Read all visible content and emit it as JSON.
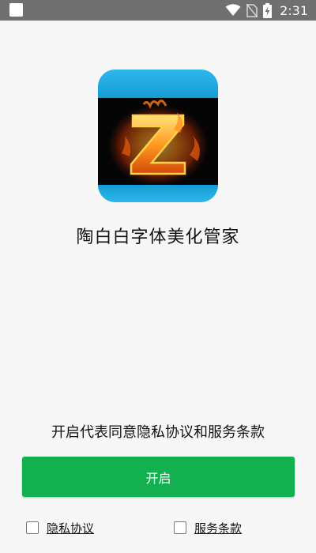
{
  "status_bar": {
    "time": "2:31",
    "icons": [
      "app-notification-icon",
      "wifi-icon",
      "no-sim-icon",
      "battery-charging-icon"
    ]
  },
  "app": {
    "title": "陶白白字体美化管家",
    "logo_letter": "Z"
  },
  "consent": {
    "text": "开启代表同意隐私协议和服务条款"
  },
  "open_button": {
    "label": "开启"
  },
  "checkboxes": [
    {
      "label": "隐私协议",
      "checked": false
    },
    {
      "label": "服务条款",
      "checked": false
    }
  ],
  "colors": {
    "status_bar": "#707070",
    "accent_green": "#12b04f",
    "logo_blue": "#1aa6dc",
    "background": "#f7f7f7"
  }
}
